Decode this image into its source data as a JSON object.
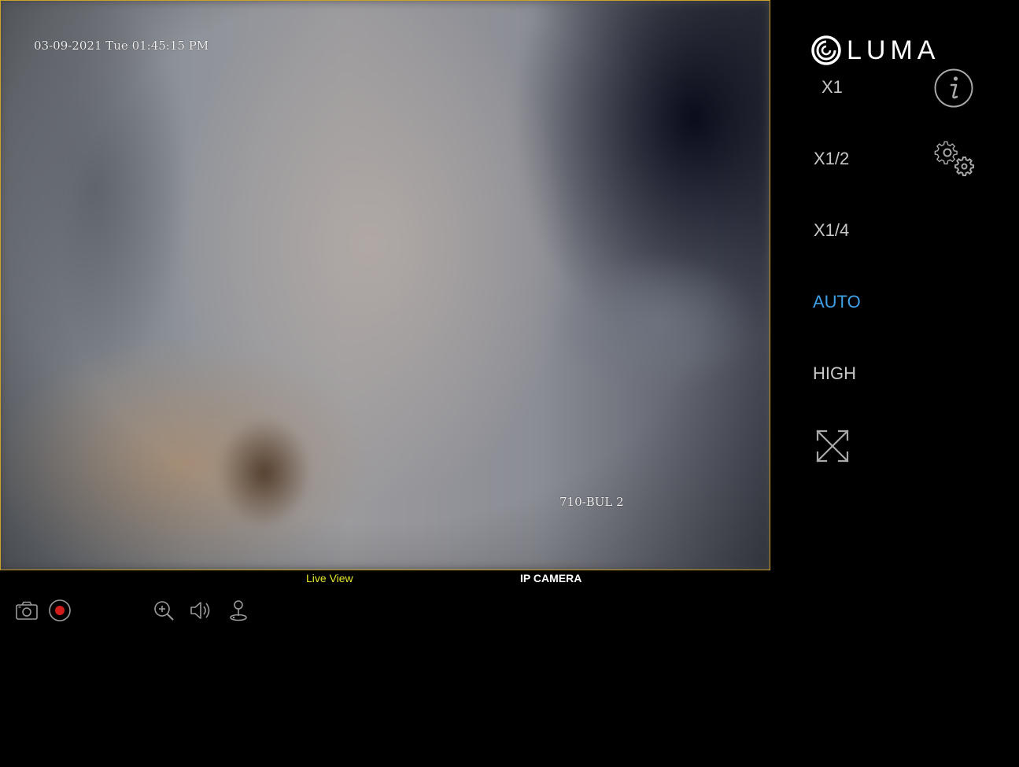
{
  "video": {
    "osd_timestamp": "03-09-2021 Tue 01:45:15 PM",
    "osd_camera_name": "710-BUL 2"
  },
  "tabs": {
    "live_view": "Live View",
    "ip_camera": "IP CAMERA"
  },
  "logo": {
    "text": "LUMA"
  },
  "stream_options": {
    "x1": "X1",
    "x1_2": "X1/2",
    "x1_4": "X1/4",
    "auto": "AUTO",
    "high": "HIGH",
    "selected": "AUTO"
  },
  "colors": {
    "frame_border": "#c9a227",
    "live_view_tab": "#e6e62a",
    "selected_option": "#3ea0e6",
    "record_dot": "#d11b1b"
  },
  "icons": {
    "bottom_toolbar": [
      "camera-icon",
      "record-icon",
      "zoom-in-icon",
      "speaker-icon",
      "ptz-joystick-icon"
    ],
    "sidebar": [
      "info-icon",
      "settings-icon",
      "fullscreen-icon"
    ]
  }
}
